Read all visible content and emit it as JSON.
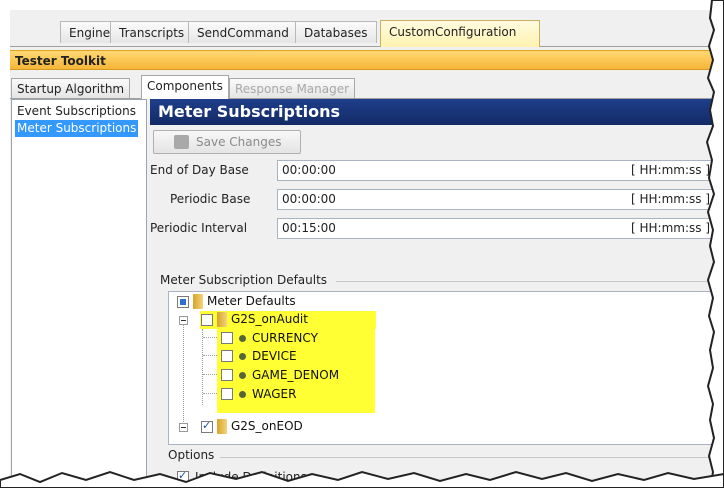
{
  "top_tabs": [
    {
      "label": "Engine"
    },
    {
      "label": "Transcripts"
    },
    {
      "label": "SendCommand"
    },
    {
      "label": "Databases"
    },
    {
      "label": "CustomConfiguration",
      "active": true
    }
  ],
  "toolkit_title": "Tester Toolkit",
  "sub_tabs": [
    {
      "label": "Startup Algorithm"
    },
    {
      "label": "Components",
      "active": true
    },
    {
      "label": "Response Manager",
      "disabled": true
    }
  ],
  "left_list": [
    {
      "label": "Event Subscriptions"
    },
    {
      "label": "Meter Subscriptions",
      "selected": true
    }
  ],
  "panel": {
    "title": "Meter Subscriptions",
    "save_label": "Save Changes",
    "fields": [
      {
        "label": "End of Day Base",
        "value": "00:00:00",
        "unit": "[ HH:mm:ss ]"
      },
      {
        "label": "Periodic Base",
        "value": "00:00:00",
        "unit": "[ HH:mm:ss ]"
      },
      {
        "label": "Periodic Interval",
        "value": "00:15:00",
        "unit": "[ HH:mm:ss ]"
      }
    ],
    "defaults_header": "Meter Subscription Defaults",
    "tree": {
      "root": "Meter Defaults",
      "group1": "G2S_onAudit",
      "children": [
        "CURRENCY",
        "DEVICE",
        "GAME_DENOM",
        "WAGER"
      ],
      "group2": "G2S_onEOD"
    },
    "options_header": "Options",
    "include_definitions": "Include Definitions"
  },
  "colors": {
    "title_bar": "#132a66",
    "toolkit_bar": "#f6b638",
    "highlight": "#ffff33",
    "selection": "#3399ff"
  }
}
